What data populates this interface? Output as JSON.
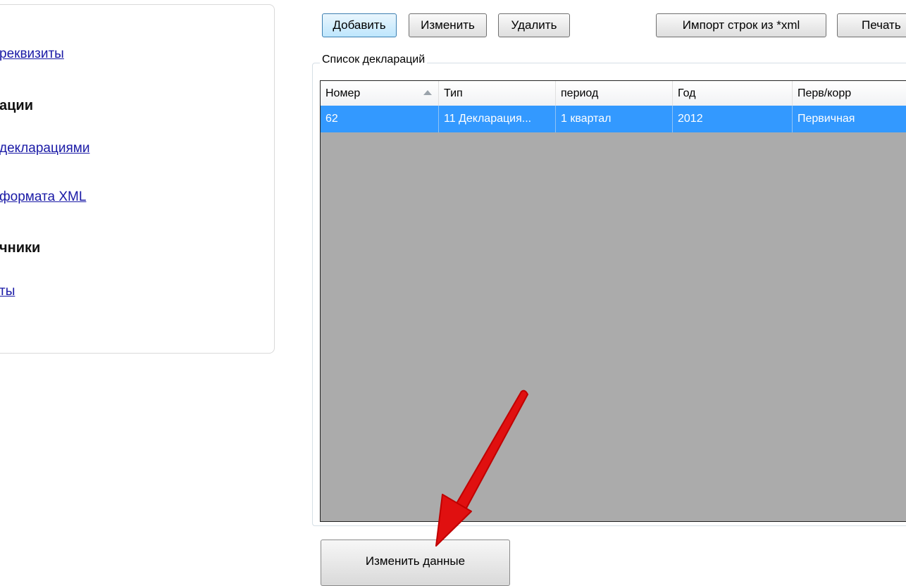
{
  "sidebar": {
    "links": [
      {
        "label": "реквизиты"
      },
      {
        "label": "декларациями"
      },
      {
        "label": "формата XML"
      },
      {
        "label": "ты"
      }
    ],
    "headings": [
      {
        "label": "ации"
      },
      {
        "label": "чники"
      }
    ]
  },
  "toolbar": {
    "add_label": "Добавить",
    "edit_label": "Изменить",
    "delete_label": "Удалить",
    "import_label": "Импорт строк из *xml",
    "print_label": "Печать"
  },
  "declarations": {
    "group_title": "Список деклараций",
    "columns": [
      "Номер",
      "Тип",
      "период",
      "Год",
      "Перв/корр"
    ],
    "rows": [
      [
        "62",
        "11 Декларация...",
        "1 квартал",
        "2012",
        "Первичная"
      ]
    ]
  },
  "footer": {
    "change_data_label": "Изменить данные"
  },
  "colors": {
    "selection": "#3399ff",
    "grid_background": "#ababab",
    "link": "#1a1aa6",
    "annotation_arrow": "#e01010"
  }
}
